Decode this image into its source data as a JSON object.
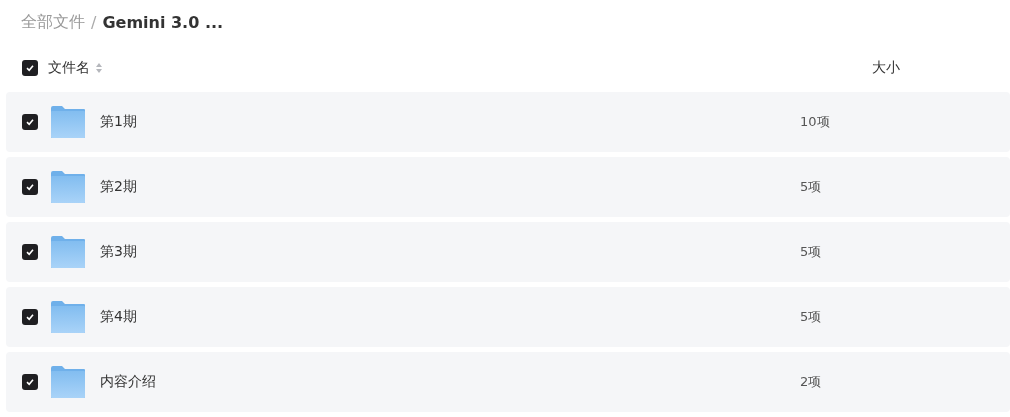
{
  "breadcrumb_separator": "/",
  "breadcrumb": [
    {
      "label": "全部文件",
      "current": false
    },
    {
      "label": "Gemini 3.0 ...",
      "current": true
    }
  ],
  "header": {
    "checked": true,
    "columns": [
      "文件名",
      "大小"
    ]
  },
  "rows": [
    {
      "name": "第1期",
      "size": "10项",
      "checked": true
    },
    {
      "name": "第2期",
      "size": "5项",
      "checked": true
    },
    {
      "name": "第3期",
      "size": "5项",
      "checked": true
    },
    {
      "name": "第4期",
      "size": "5项",
      "checked": true
    },
    {
      "name": "内容介绍",
      "size": "2项",
      "checked": true
    }
  ]
}
